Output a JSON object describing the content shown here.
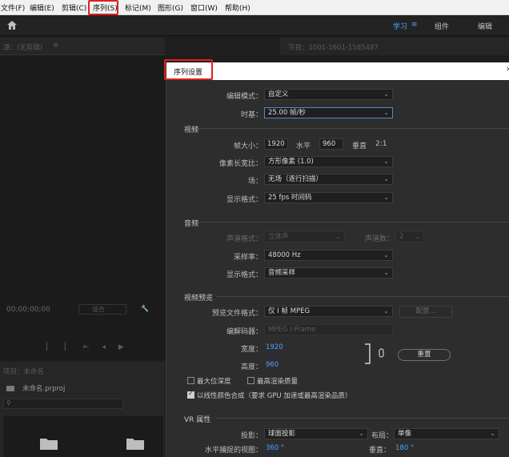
{
  "menubar": {
    "items": [
      "文件(F)",
      "编辑(E)",
      "剪辑(C)",
      "序列(S)",
      "标记(M)",
      "图形(G)",
      "窗口(W)",
      "帮助(H)"
    ]
  },
  "topbar": {
    "workspaces": [
      "学习",
      "组件",
      "编辑"
    ]
  },
  "source_panel": {
    "title": "源：(无剪辑)",
    "timecode": "00;00;00;00",
    "fit": "适合"
  },
  "program_header": {
    "title": "节目：1001-1601-1585487"
  },
  "project_panel": {
    "title": "项目：未命名",
    "file": "未命名.prproj"
  },
  "dialog": {
    "title": "序列设置",
    "edit_mode_label": "编辑模式：",
    "edit_mode_value": "自定义",
    "timebase_label": "时基：",
    "timebase_value": "25.00 帧/秒",
    "video_section": "视频",
    "frame_size_label": "帧大小：",
    "frame_width": "1920",
    "horizontal_label": "水平",
    "frame_height": "960",
    "vertical_label": "垂直",
    "aspect_ratio": "2:1",
    "pixel_aspect_label": "像素长宽比：",
    "pixel_aspect_value": "方形像素 (1.0)",
    "fields_label": "场：",
    "fields_value": "无场（逐行扫描）",
    "video_display_label": "显示格式：",
    "video_display_value": "25 fps 时间码",
    "audio_section": "音频",
    "channel_format_label": "声道格式：",
    "channel_format_value": "立体声",
    "channels_label": "声道数：",
    "channels_value": "2",
    "sample_rate_label": "采样率：",
    "sample_rate_value": "48000 Hz",
    "audio_display_label": "显示格式：",
    "audio_display_value": "音频采样",
    "preview_section": "视频预览",
    "preview_format_label": "预览文件格式：",
    "preview_format_value": "仅 I 帧 MPEG",
    "configure_label": "配置...",
    "codec_label": "编解码器：",
    "codec_value": "MPEG I-Frame",
    "width_label": "宽度：",
    "width_value": "1920",
    "height_label": "高度：",
    "height_value": "960",
    "reset_label": "重置",
    "max_bit_depth_label": "最大位深度",
    "max_render_quality_label": "最高渲染质量",
    "linear_color_label": "以线性颜色合成（要求 GPU 加速或最高渲染品质）",
    "linear_color_checked": true,
    "vr_section": "VR 属性",
    "projection_label": "投影：",
    "projection_value": "球面投影",
    "layout_label": "布局：",
    "layout_value": "单像",
    "horizontal_view_label": "水平捕捉的视图：",
    "horizontal_view_value": "360 °",
    "vertical_view_label": "垂直：",
    "vertical_view_value": "180 °"
  },
  "colors": {
    "highlight_red": "#e0201b",
    "accent_blue": "#4aa3ff",
    "dialog_bg": "#2d2d2d"
  }
}
